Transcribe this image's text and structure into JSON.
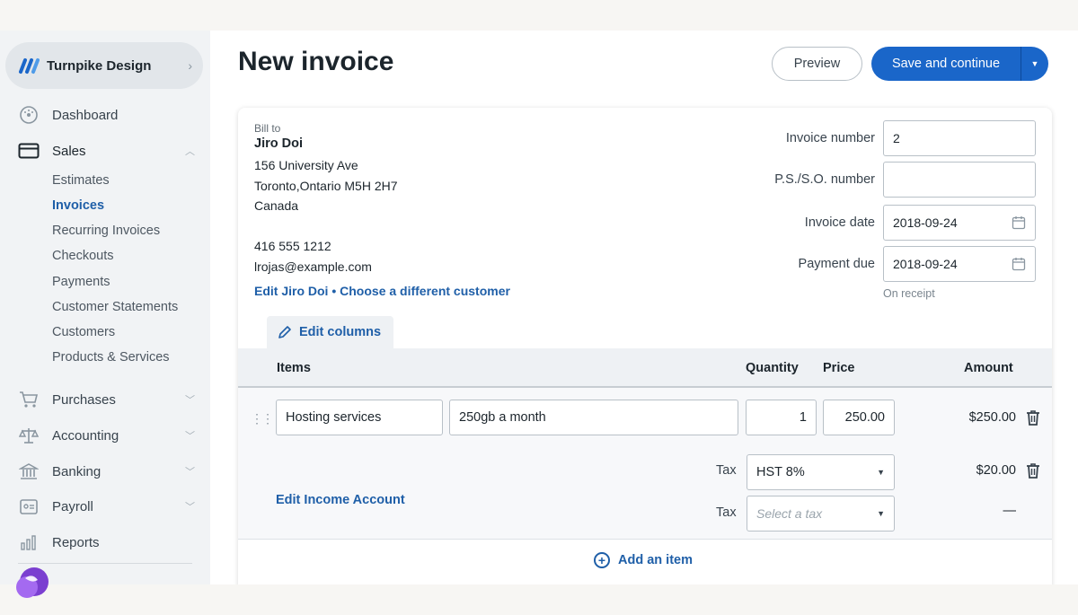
{
  "business": {
    "name": "Turnpike Design"
  },
  "nav": {
    "dashboard": "Dashboard",
    "sales": "Sales",
    "sales_items": [
      "Estimates",
      "Invoices",
      "Recurring Invoices",
      "Checkouts",
      "Payments",
      "Customer Statements",
      "Customers",
      "Products & Services"
    ],
    "active_item": "Invoices",
    "purchases": "Purchases",
    "accounting": "Accounting",
    "banking": "Banking",
    "payroll": "Payroll",
    "reports": "Reports"
  },
  "header": {
    "title": "New invoice",
    "preview_label": "Preview",
    "save_label": "Save and continue"
  },
  "bill_to": {
    "label": "Bill to",
    "name": "Jiro Doi",
    "address1": "156 University Ave",
    "address2": "Toronto,Ontario M5H 2H7",
    "country": "Canada",
    "phone": "416 555 1212",
    "email": "lrojas@example.com",
    "edit_link": "Edit Jiro Doi",
    "separator": "•",
    "choose_link": "Choose a different customer"
  },
  "fields": {
    "invoice_number_label": "Invoice number",
    "invoice_number": "2",
    "po_label": "P.S./S.O. number",
    "po_value": "",
    "invoice_date_label": "Invoice date",
    "invoice_date": "2018-09-24",
    "payment_due_label": "Payment due",
    "payment_due": "2018-09-24",
    "payment_note": "On receipt"
  },
  "table": {
    "edit_columns": "Edit columns",
    "headers": {
      "items": "Items",
      "quantity": "Quantity",
      "price": "Price",
      "amount": "Amount"
    },
    "line": {
      "item": "Hosting services",
      "description": "250gb a month",
      "quantity": "1",
      "price": "250.00",
      "amount": "$250.00"
    },
    "tax_label": "Tax",
    "tax1": {
      "value": "HST 8%",
      "amount": "$20.00"
    },
    "tax2": {
      "placeholder": "Select a tax",
      "amount": "—"
    },
    "edit_income": "Edit Income Account",
    "add_item": "Add an item"
  },
  "colors": {
    "accent": "#1a66c9",
    "link": "#1f5fa8"
  }
}
